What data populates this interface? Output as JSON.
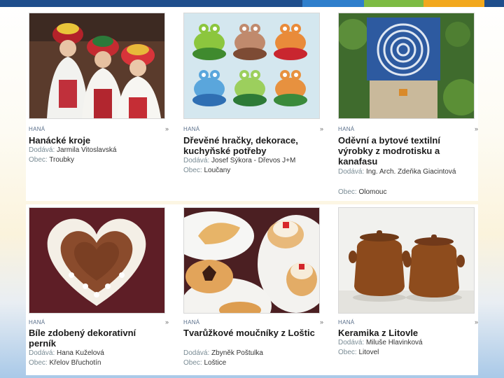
{
  "colors": {
    "bar": [
      "#1f4e8c",
      "#2e7fcc",
      "#7dbb43",
      "#f2a81d",
      "#1f4e8c"
    ],
    "region": "#5a6f8a",
    "key": "#7a8c95"
  },
  "cards": [
    {
      "region": "HANÁ",
      "arrow": "»",
      "title": "Hanácké kroje",
      "supplier_label": "Dodává:",
      "supplier": "Jarmila Vitoslavská",
      "town_label": "Obec:",
      "town": "Troubky",
      "image": "folk-costumes"
    },
    {
      "region": "HANÁ",
      "arrow": "»",
      "title": "Dřevěné hračky, dekorace, kuchyňské potřeby",
      "supplier_label": "Dodává:",
      "supplier": "Josef Sýkora - Dřevos J+M",
      "town_label": "Obec:",
      "town": "Loučany",
      "image": "wooden-frogs"
    },
    {
      "region": "HANÁ",
      "arrow": "»",
      "title": "Oděvní a bytové textilní výrobky z modrotisku a kanafasu",
      "supplier_label": "Dodává:",
      "supplier": "Ing. Arch. Zdeňka Giacintová",
      "town_label": "Obec:",
      "town": "Olomouc",
      "image": "blueprint-bag"
    },
    {
      "region": "HANÁ",
      "arrow": "»",
      "title": "Bíle zdobený dekorativní perník",
      "supplier_label": "Dodává:",
      "supplier": "Hana Kuželová",
      "town_label": "Obec:",
      "town": "Křelov Břuchotín",
      "image": "gingerbread-heart"
    },
    {
      "region": "HANÁ",
      "arrow": "»",
      "title": "Tvarůžkové moučníky z Loštic",
      "supplier_label": "Dodává:",
      "supplier": "Zbyněk Poštulka",
      "town_label": "Obec:",
      "town": "Loštice",
      "image": "cheese-pastries"
    },
    {
      "region": "HANÁ",
      "arrow": "»",
      "title": "Keramika z Litovle",
      "supplier_label": "Dodává:",
      "supplier": "Miluše Hlavinková",
      "town_label": "Obec:",
      "town": "Litovel",
      "image": "ceramic-pots"
    }
  ]
}
